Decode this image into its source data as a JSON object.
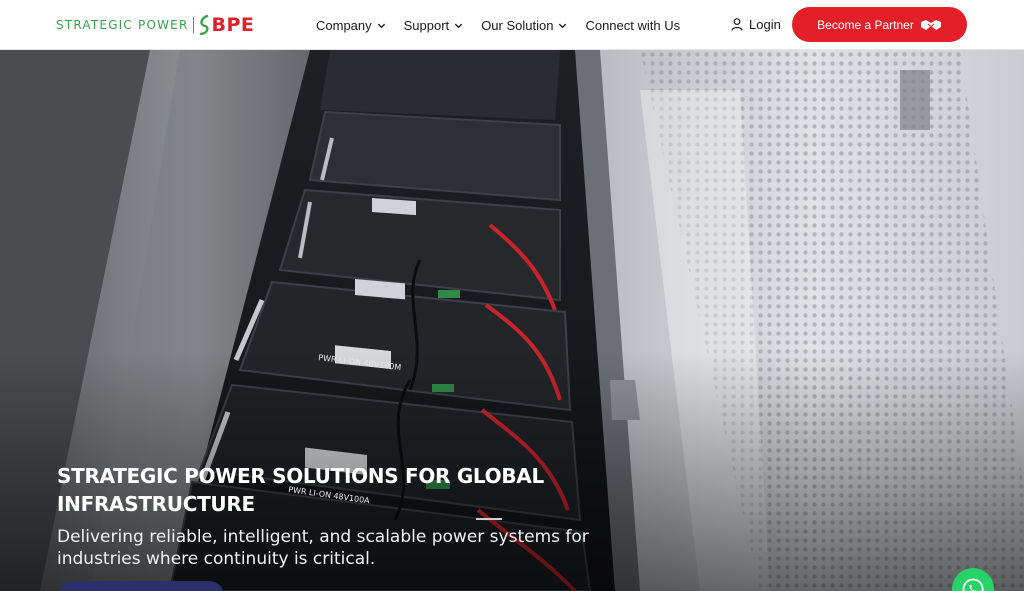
{
  "header": {
    "logo_text": "STRATEGIC POWER",
    "logo_mark": "BPE",
    "nav": [
      {
        "label": "Company",
        "icon": "chevron-down-icon"
      },
      {
        "label": "Support",
        "icon": "chevron-down-icon"
      },
      {
        "label": "Our Solution",
        "icon": "chevron-down-icon"
      },
      {
        "label": "Connect with Us"
      }
    ],
    "login_label": "Login",
    "partner_label": "Become a Partner"
  },
  "hero": {
    "title": "STRATEGIC POWER SOLUTIONS FOR GLOBAL INFRASTRUCTURE",
    "subtitle": "Delivering reliable, intelligent, and scalable power systems for industries where continuity is critical.",
    "module_label_1": "PWR LI-ON 48V100M",
    "module_label_2": "PWR LI-ON 48V100A"
  },
  "colors": {
    "brand_red": "#e3202a",
    "brand_green": "#3aa04a",
    "cta_navy": "#2b2f6b",
    "whatsapp_green": "#25d366"
  }
}
